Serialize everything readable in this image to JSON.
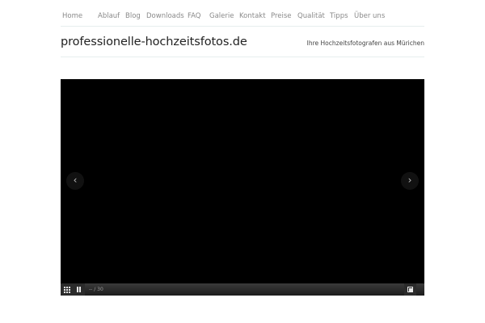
{
  "nav": {
    "items": [
      {
        "label": "Home"
      },
      {
        "label": "Ablauf"
      },
      {
        "label": "Blog"
      },
      {
        "label": "Downloads"
      },
      {
        "label": "FAQ"
      },
      {
        "label": "Galerie"
      },
      {
        "label": "Kontakt"
      },
      {
        "label": "Preise"
      },
      {
        "label": "Qualität"
      },
      {
        "label": "Tipps"
      },
      {
        "label": "Über uns"
      }
    ]
  },
  "header": {
    "title": "professionelle-hochzeitsfotos.de",
    "tagline": "Ihre Hochzeitsfotografen aus Mürichen"
  },
  "slideshow": {
    "prev_glyph": "‹",
    "next_glyph": "›",
    "counter": "-- / 30",
    "controls": {
      "grid_icon": "grid-icon",
      "pause_icon": "pause-icon",
      "fullscreen_icon": "fullscreen-icon"
    }
  },
  "colors": {
    "nav_text": "#8a8a8a",
    "title_text": "#222222",
    "rule": "#e6eeee",
    "slideshow_bg": "#000000"
  }
}
